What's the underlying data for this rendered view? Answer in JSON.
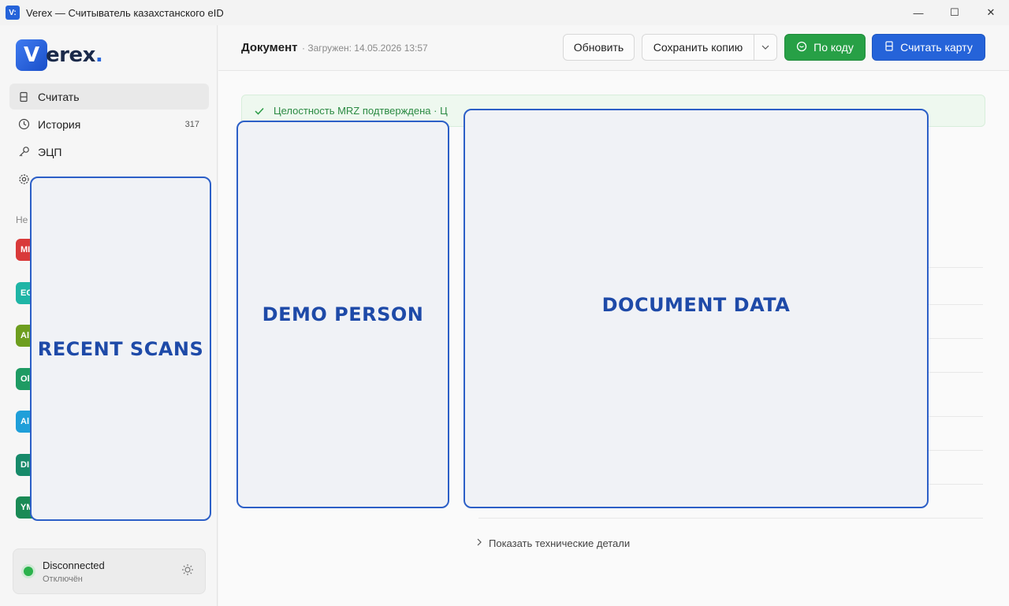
{
  "window": {
    "icon_text": "V:",
    "title": "Verex — Считыватель казахстанского eID",
    "minimize_glyph": "—",
    "maximize_glyph": "☐",
    "close_glyph": "✕"
  },
  "logo": {
    "badge_letter": "V",
    "text": "erex",
    "dot": "."
  },
  "sidebar": {
    "nav": [
      {
        "label": "Считать",
        "icon": "card-icon",
        "active": true
      },
      {
        "label": "История",
        "icon": "clock-icon",
        "count": "317"
      },
      {
        "label": "ЭЦП",
        "icon": "key-icon"
      },
      {
        "label": "",
        "icon": "gear-icon"
      }
    ],
    "section_label": "Не",
    "recent_avatars": [
      {
        "text": "MI",
        "color": "#d93a3a"
      },
      {
        "text": "EC",
        "color": "#1fb5a6"
      },
      {
        "text": "Al",
        "color": "#6e9e1f"
      },
      {
        "text": "Ol",
        "color": "#1e9b63"
      },
      {
        "text": "Al",
        "color": "#1f9fd9"
      },
      {
        "text": "DI",
        "color": "#178a6a"
      },
      {
        "text": "YM",
        "color": "#1a8a55"
      }
    ],
    "recent_placeholder": "RECENT SCANS",
    "status": {
      "title": "Disconnected",
      "subtitle": "Отключён",
      "theme_icon": "sun-icon"
    }
  },
  "header": {
    "title": "Документ",
    "loaded": "· Загружен: 14.05.2026 13:57",
    "refresh": "Обновить",
    "save_copy": "Сохранить копию",
    "save_dropdown": "⌄",
    "by_code": "По коду",
    "read_card": "Считать карту"
  },
  "alert": {
    "text": "Целостность MRZ подтверждена · Ц"
  },
  "placeholders": {
    "person": "DEMO PERSON",
    "document": "DOCUMENT DATA"
  },
  "tech_details": "Показать технические детали",
  "colors": {
    "accent": "#2563d9",
    "success": "#27a046",
    "placeholder_border": "#2c5fc7"
  }
}
